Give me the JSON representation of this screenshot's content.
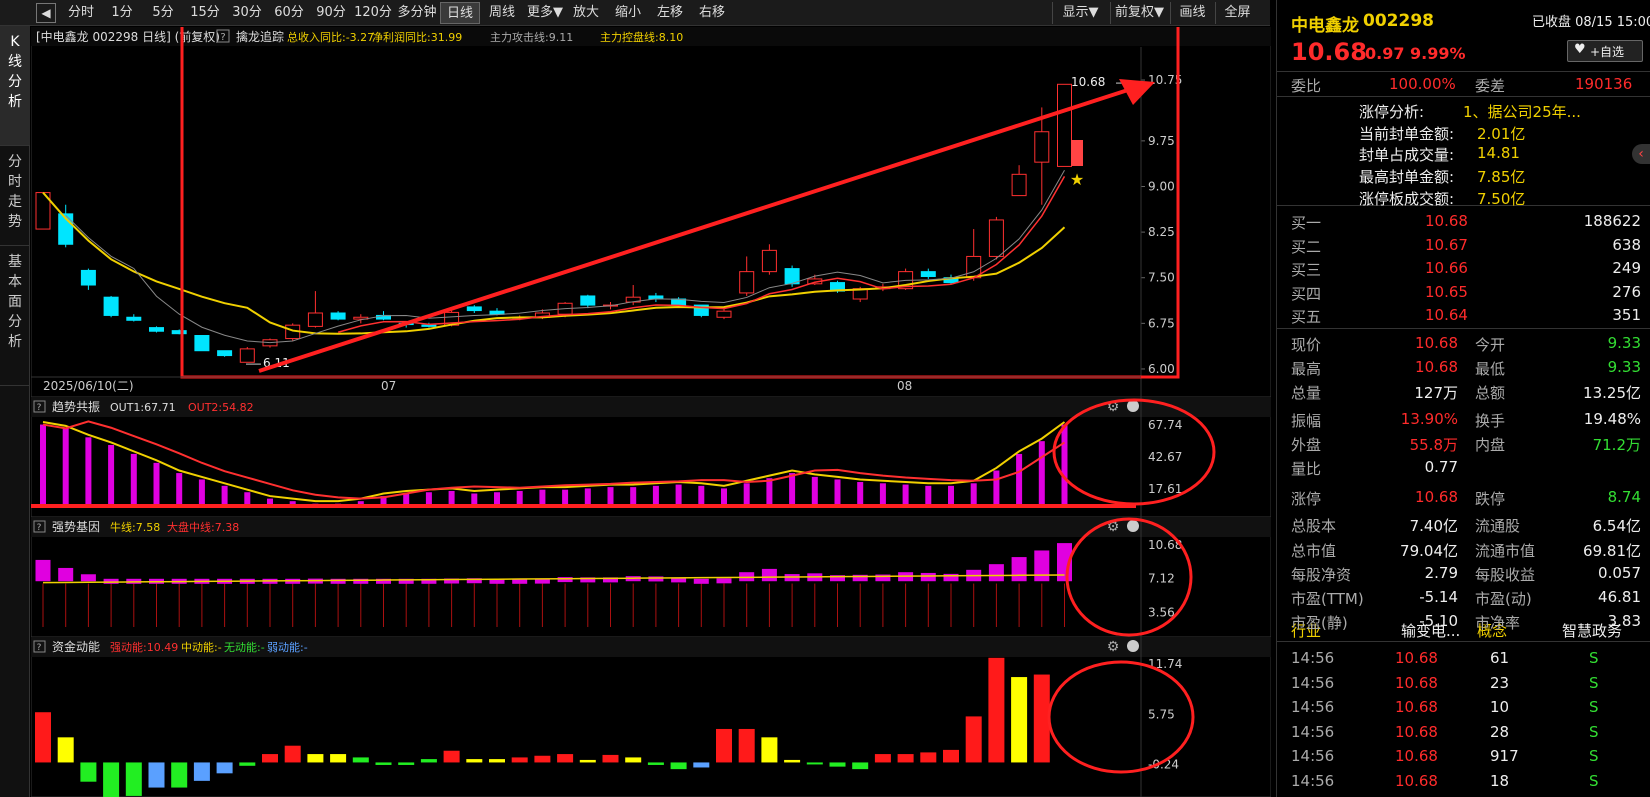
{
  "toolbar": {
    "items": [
      "分时",
      "1分",
      "5分",
      "15分",
      "30分",
      "60分",
      "90分",
      "120分",
      "多分钟",
      "日线",
      "周线",
      "更多▼",
      "放大",
      "缩小",
      "左移",
      "右移"
    ],
    "active": "日线",
    "right_items": [
      "显示▼",
      "前复权▼",
      "画线",
      "全屏"
    ],
    "back_icon": "◀"
  },
  "left_tabs": [
    "K线分析",
    "分时走势",
    "基本面分析"
  ],
  "chart": {
    "header_label": "[中电鑫龙 002298 日线] (前复权)",
    "help_icon": "?",
    "indicator_name": "擒龙追踪",
    "ind_items": [
      {
        "label": "总收入同比:-3.27",
        "color": "#f0d000"
      },
      {
        "label": "净利润同比:31.99",
        "color": "#f0d000"
      },
      {
        "label": "主力攻击线:9.11",
        "color": "#aaa"
      },
      {
        "label": "主力控盘线:8.10",
        "color": "#f0d000"
      }
    ],
    "date_label": "2025/06/10(二)",
    "month_labels": [
      "07",
      "08"
    ],
    "price_axis": [
      "10.75",
      "9.75",
      "9.00",
      "8.25",
      "7.50",
      "6.75",
      "6.00"
    ],
    "high_label": "10.68",
    "low_label": "6.11",
    "panel2": {
      "name": "趋势共振",
      "items": [
        {
          "label": "OUT1:67.71",
          "color": "#ddd"
        },
        {
          "label": "OUT2:54.82",
          "color": "#ff3030"
        }
      ],
      "axis": [
        "67.74",
        "42.67",
        "17.61"
      ]
    },
    "panel3": {
      "name": "强势基因",
      "items": [
        {
          "label": "牛线:7.58",
          "color": "#f0d000"
        },
        {
          "label": "大盘中线:7.38",
          "color": "#ff3030"
        }
      ],
      "axis": [
        "10.68",
        "7.12",
        "3.56"
      ]
    },
    "panel4": {
      "name": "资金动能",
      "items": [
        {
          "label": "强动能:10.49",
          "color": "#ff3030"
        },
        {
          "label": "中动能:-",
          "color": "#f0d000"
        },
        {
          "label": "无动能:-",
          "color": "#33dd33"
        },
        {
          "label": "弱动能:-",
          "color": "#5aa0ff"
        }
      ],
      "axis": [
        "11.74",
        "5.75",
        "-0.24"
      ]
    }
  },
  "chart_data": {
    "type": "candlestick",
    "dates_labels": [
      "2025/06/10",
      "07",
      "08"
    ],
    "candles": [
      [
        8.3,
        8.9,
        8.9,
        8.3
      ],
      [
        8.55,
        8.05,
        8.7,
        8.0
      ],
      [
        7.62,
        7.38,
        7.65,
        7.3
      ],
      [
        7.18,
        6.88,
        7.2,
        6.85
      ],
      [
        6.85,
        6.8,
        6.9,
        6.78
      ],
      [
        6.68,
        6.62,
        6.7,
        6.6
      ],
      [
        6.63,
        6.58,
        6.65,
        6.57
      ],
      [
        6.55,
        6.3,
        6.55,
        6.3
      ],
      [
        6.3,
        6.22,
        6.3,
        6.2
      ],
      [
        6.11,
        6.33,
        6.36,
        6.11
      ],
      [
        6.38,
        6.48,
        6.5,
        6.35
      ],
      [
        6.5,
        6.72,
        6.75,
        6.46
      ],
      [
        6.7,
        6.92,
        7.28,
        6.68
      ],
      [
        6.92,
        6.82,
        6.95,
        6.8
      ],
      [
        6.82,
        6.85,
        6.9,
        6.75
      ],
      [
        6.88,
        6.82,
        6.95,
        6.8
      ],
      [
        6.75,
        6.73,
        6.78,
        6.68
      ],
      [
        6.72,
        6.7,
        6.76,
        6.68
      ],
      [
        6.72,
        6.93,
        6.98,
        6.7
      ],
      [
        7.02,
        6.96,
        7.05,
        6.92
      ],
      [
        6.95,
        6.9,
        7.0,
        6.88
      ],
      [
        6.85,
        6.85,
        6.88,
        6.8
      ],
      [
        6.85,
        6.92,
        6.98,
        6.82
      ],
      [
        6.9,
        7.08,
        7.1,
        6.85
      ],
      [
        7.2,
        7.05,
        7.22,
        7.0
      ],
      [
        7.05,
        7.05,
        7.1,
        6.98
      ],
      [
        7.1,
        7.18,
        7.38,
        7.05
      ],
      [
        7.2,
        7.15,
        7.25,
        7.1
      ],
      [
        7.15,
        7.05,
        7.18,
        7.02
      ],
      [
        7.05,
        6.88,
        7.05,
        6.85
      ],
      [
        6.85,
        6.95,
        7.0,
        6.82
      ],
      [
        7.25,
        7.6,
        7.85,
        7.2
      ],
      [
        7.6,
        7.95,
        8.05,
        7.55
      ],
      [
        7.65,
        7.4,
        7.7,
        7.35
      ],
      [
        7.4,
        7.48,
        7.55,
        7.38
      ],
      [
        7.42,
        7.28,
        7.45,
        7.25
      ],
      [
        7.15,
        7.32,
        7.35,
        7.1
      ],
      [
        7.32,
        7.35,
        7.4,
        7.28
      ],
      [
        7.32,
        7.6,
        7.65,
        7.3
      ],
      [
        7.6,
        7.52,
        7.65,
        7.48
      ],
      [
        7.5,
        7.42,
        7.55,
        7.4
      ],
      [
        7.5,
        7.85,
        8.3,
        7.45
      ],
      [
        7.85,
        8.45,
        8.5,
        7.8
      ],
      [
        8.85,
        9.2,
        9.35,
        8.85
      ],
      [
        9.4,
        9.9,
        10.3,
        8.7
      ],
      [
        9.33,
        10.68,
        10.68,
        9.33
      ]
    ],
    "ma_yellow_end": 8.1,
    "ma_red_end": 9.11,
    "out1": 67.71,
    "out2": 54.82,
    "bull_line": 7.58,
    "market_mid": 7.38,
    "strong_energy": 10.49
  },
  "quote": {
    "name": "中电鑫龙",
    "code": "002298",
    "status": "已收盘 08/15 15:00",
    "price": "10.68",
    "change": "0.97",
    "pct": "9.99%",
    "fav_label": "+自选",
    "heart_icon": "♥",
    "webi_label": "委比",
    "webi_val": "100.00%",
    "weicha_label": "委差",
    "weicha_val": "190136",
    "limit": [
      {
        "k": "涨停分析:",
        "v": "1、据公司25年..."
      },
      {
        "k": "当前封单金额:",
        "v": "2.01亿"
      },
      {
        "k": "封单占成交量:",
        "v": "14.81"
      },
      {
        "k": "最高封单金额:",
        "v": "7.85亿"
      },
      {
        "k": "涨停板成交额:",
        "v": "7.50亿"
      }
    ],
    "buys": [
      {
        "k": "买一",
        "p": "10.68",
        "v": "188622"
      },
      {
        "k": "买二",
        "p": "10.67",
        "v": "638"
      },
      {
        "k": "买三",
        "p": "10.66",
        "v": "249"
      },
      {
        "k": "买四",
        "p": "10.65",
        "v": "276"
      },
      {
        "k": "买五",
        "p": "10.64",
        "v": "351"
      }
    ],
    "stats": [
      {
        "k1": "现价",
        "v1": "10.68",
        "c1": "red",
        "k2": "今开",
        "v2": "9.33",
        "c2": "green"
      },
      {
        "k1": "最高",
        "v1": "10.68",
        "c1": "red",
        "k2": "最低",
        "v2": "9.33",
        "c2": "green"
      },
      {
        "k1": "总量",
        "v1": "127万",
        "c1": "white",
        "k2": "总额",
        "v2": "13.25亿",
        "c2": "white"
      },
      {
        "k1": "振幅",
        "v1": "13.90%",
        "c1": "red",
        "k2": "换手",
        "v2": "19.48%",
        "c2": "white"
      },
      {
        "k1": "外盘",
        "v1": "55.8万",
        "c1": "red",
        "k2": "内盘",
        "v2": "71.2万",
        "c2": "green"
      },
      {
        "k1": "量比",
        "v1": "0.77",
        "c1": "white",
        "k2": "",
        "v2": "",
        "c2": "white"
      },
      {
        "k1": "涨停",
        "v1": "10.68",
        "c1": "red",
        "k2": "跌停",
        "v2": "8.74",
        "c2": "green"
      },
      {
        "k1": "总股本",
        "v1": "7.40亿",
        "c1": "white",
        "k2": "流通股",
        "v2": "6.54亿",
        "c2": "white"
      },
      {
        "k1": "总市值",
        "v1": "79.04亿",
        "c1": "white",
        "k2": "流通市值",
        "v2": "69.81亿",
        "c2": "white"
      },
      {
        "k1": "每股净资",
        "v1": "2.79",
        "c1": "white",
        "k2": "每股收益",
        "v2": "0.057",
        "c2": "white"
      },
      {
        "k1": "市盈(TTM)",
        "v1": "-5.14",
        "c1": "white",
        "k2": "市盈(动)",
        "v2": "46.81",
        "c2": "white"
      },
      {
        "k1": "市盈(静)",
        "v1": "-5.10",
        "c1": "white",
        "k2": "市净率",
        "v2": "3.83",
        "c2": "white"
      }
    ],
    "industry_label": "行业",
    "industry_val": "输变电...",
    "concept_label": "概念",
    "concept_val": "智慧政务",
    "ticks": [
      {
        "t": "14:56",
        "p": "10.68",
        "v": "61",
        "s": "S"
      },
      {
        "t": "14:56",
        "p": "10.68",
        "v": "23",
        "s": "S"
      },
      {
        "t": "14:56",
        "p": "10.68",
        "v": "10",
        "s": "S"
      },
      {
        "t": "14:56",
        "p": "10.68",
        "v": "28",
        "s": "S"
      },
      {
        "t": "14:56",
        "p": "10.68",
        "v": "917",
        "s": "S"
      },
      {
        "t": "14:56",
        "p": "10.68",
        "v": "18",
        "s": "S"
      }
    ],
    "collapse_icon": "‹"
  },
  "colors": {
    "up": "#ff3030",
    "down": "#00e5ff",
    "yellow": "#f0d000",
    "magenta": "#e000e0",
    "bg": "#000000"
  }
}
